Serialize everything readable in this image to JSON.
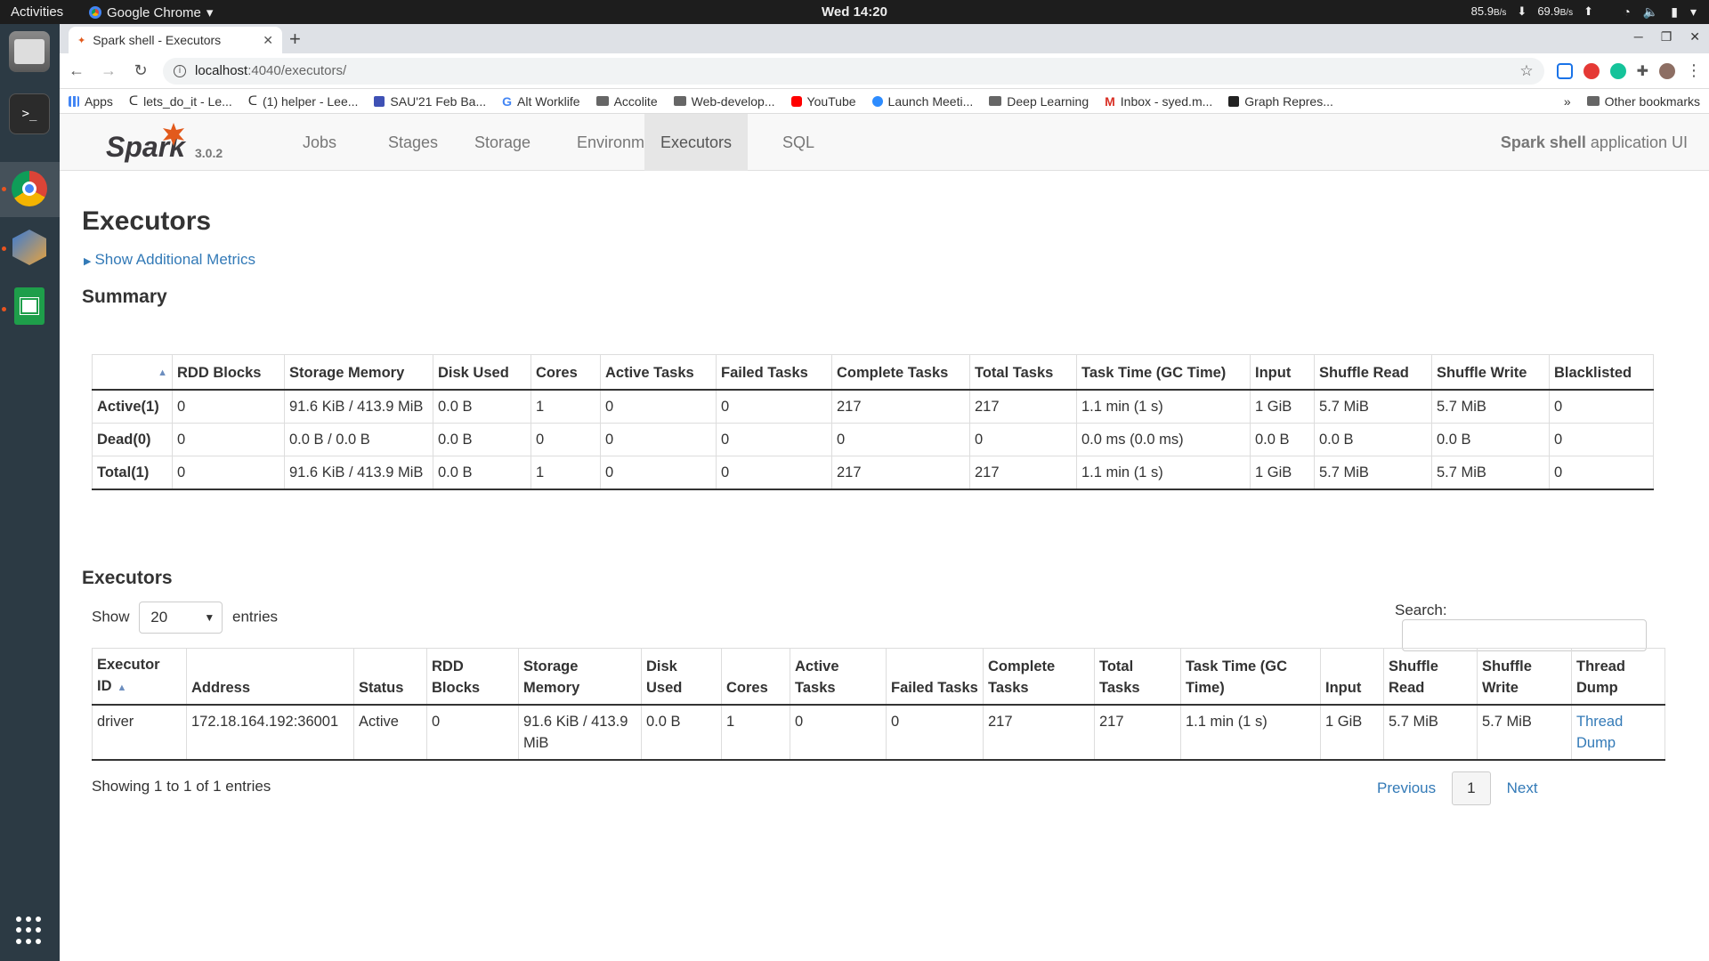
{
  "topbar": {
    "activities": "Activities",
    "app_name": "Google Chrome",
    "clock": "Wed 14:20",
    "net_down": "85.9",
    "net_down_unit": "B/s",
    "net_up": "69.9",
    "net_up_unit": "B/s"
  },
  "browser": {
    "tab_title": "Spark shell - Executors",
    "url_host": "localhost",
    "url_path": ":4040/executors/",
    "bookmarks": [
      "Apps",
      "lets_do_it - Le...",
      "(1) helper - Lee...",
      "SAU'21 Feb Ba...",
      "Alt Worklife",
      "Accolite",
      "Web-develop...",
      "YouTube",
      "Launch Meeti...",
      "Deep Learning",
      "Inbox - syed.m...",
      "Graph Repres..."
    ],
    "bookmarks_overflow": "»",
    "other_bookmarks": "Other bookmarks"
  },
  "spark": {
    "version": "3.0.2",
    "nav": [
      "Jobs",
      "Stages",
      "Storage",
      "Environment",
      "Executors",
      "SQL"
    ],
    "app_title_bold": "Spark shell",
    "app_title_rest": " application UI"
  },
  "page": {
    "title": "Executors",
    "show_metrics": "Show Additional Metrics",
    "summary_heading": "Summary",
    "executors_heading": "Executors"
  },
  "summary": {
    "headers": [
      "",
      "RDD Blocks",
      "Storage Memory",
      "Disk Used",
      "Cores",
      "Active Tasks",
      "Failed Tasks",
      "Complete Tasks",
      "Total Tasks",
      "Task Time (GC Time)",
      "Input",
      "Shuffle Read",
      "Shuffle Write",
      "Blacklisted"
    ],
    "rows": [
      [
        "Active(1)",
        "0",
        "91.6 KiB / 413.9 MiB",
        "0.0 B",
        "1",
        "0",
        "0",
        "217",
        "217",
        "1.1 min (1 s)",
        "1 GiB",
        "5.7 MiB",
        "5.7 MiB",
        "0"
      ],
      [
        "Dead(0)",
        "0",
        "0.0 B / 0.0 B",
        "0.0 B",
        "0",
        "0",
        "0",
        "0",
        "0",
        "0.0 ms (0.0 ms)",
        "0.0 B",
        "0.0 B",
        "0.0 B",
        "0"
      ],
      [
        "Total(1)",
        "0",
        "91.6 KiB / 413.9 MiB",
        "0.0 B",
        "1",
        "0",
        "0",
        "217",
        "217",
        "1.1 min (1 s)",
        "1 GiB",
        "5.7 MiB",
        "5.7 MiB",
        "0"
      ]
    ]
  },
  "executors": {
    "show_label": "Show",
    "page_size": "20",
    "entries_label": "entries",
    "search_label": "Search:",
    "headers": [
      "Executor ID",
      "Address",
      "Status",
      "RDD Blocks",
      "Storage Memory",
      "Disk Used",
      "Cores",
      "Active Tasks",
      "Failed Tasks",
      "Complete Tasks",
      "Total Tasks",
      "Task Time (GC Time)",
      "Input",
      "Shuffle Read",
      "Shuffle Write",
      "Thread Dump"
    ],
    "rows": [
      [
        "driver",
        "172.18.164.192:36001",
        "Active",
        "0",
        "91.6 KiB / 413.9 MiB",
        "0.0 B",
        "1",
        "0",
        "0",
        "217",
        "217",
        "1.1 min (1 s)",
        "1 GiB",
        "5.7 MiB",
        "5.7 MiB",
        "Thread Dump"
      ]
    ],
    "info": "Showing 1 to 1 of 1 entries",
    "prev": "Previous",
    "current_page": "1",
    "next": "Next"
  }
}
